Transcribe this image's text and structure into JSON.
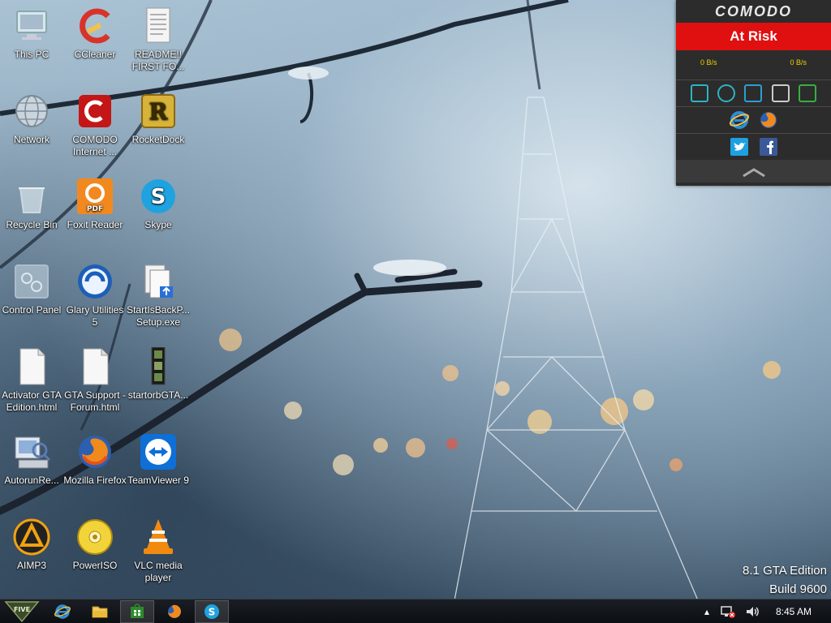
{
  "desktop": {
    "icons": [
      {
        "label": "This PC",
        "icon": "this-pc-icon"
      },
      {
        "label": "CCleaner",
        "icon": "ccleaner-icon"
      },
      {
        "label": "README!! FIRST FO...",
        "icon": "text-document-icon"
      },
      {
        "label": "Network",
        "icon": "network-icon"
      },
      {
        "label": "COMODO Internet ...",
        "icon": "comodo-internet-security-icon"
      },
      {
        "label": "RocketDock",
        "icon": "rocketdock-icon"
      },
      {
        "label": "Recycle Bin",
        "icon": "recycle-bin-icon"
      },
      {
        "label": "Foxit Reader",
        "icon": "foxit-reader-icon"
      },
      {
        "label": "Skype",
        "icon": "skype-icon"
      },
      {
        "label": "Control Panel",
        "icon": "control-panel-icon"
      },
      {
        "label": "Glary Utilities 5",
        "icon": "glary-utilities-icon"
      },
      {
        "label": "StartIsBackP... Setup.exe",
        "icon": "setup-exe-icon"
      },
      {
        "label": "Activator GTA Edition.html",
        "icon": "html-file-icon"
      },
      {
        "label": "GTA Support - Forum.html",
        "icon": "html-file-icon"
      },
      {
        "label": "startorbGTA...",
        "icon": "startorb-image-icon"
      },
      {
        "label": "AutorunRe...",
        "icon": "autorun-icon"
      },
      {
        "label": "Mozilla Firefox",
        "icon": "firefox-icon"
      },
      {
        "label": "TeamViewer 9",
        "icon": "teamviewer-icon"
      },
      {
        "label": "AIMP3",
        "icon": "aimp-icon"
      },
      {
        "label": "PowerISO",
        "icon": "poweriso-icon"
      },
      {
        "label": "VLC media player",
        "icon": "vlc-icon"
      }
    ]
  },
  "comodo": {
    "brand": "COMODO",
    "status": "At Risk",
    "download_rate": "0 B/s",
    "upload_rate": "0 B/s",
    "status_color": "#e01010"
  },
  "watermark": {
    "line1": "8.1 GTA Edition",
    "line2": "Build 9600"
  },
  "taskbar": {
    "start_label": "FIVE",
    "clock": "8:45 AM"
  }
}
